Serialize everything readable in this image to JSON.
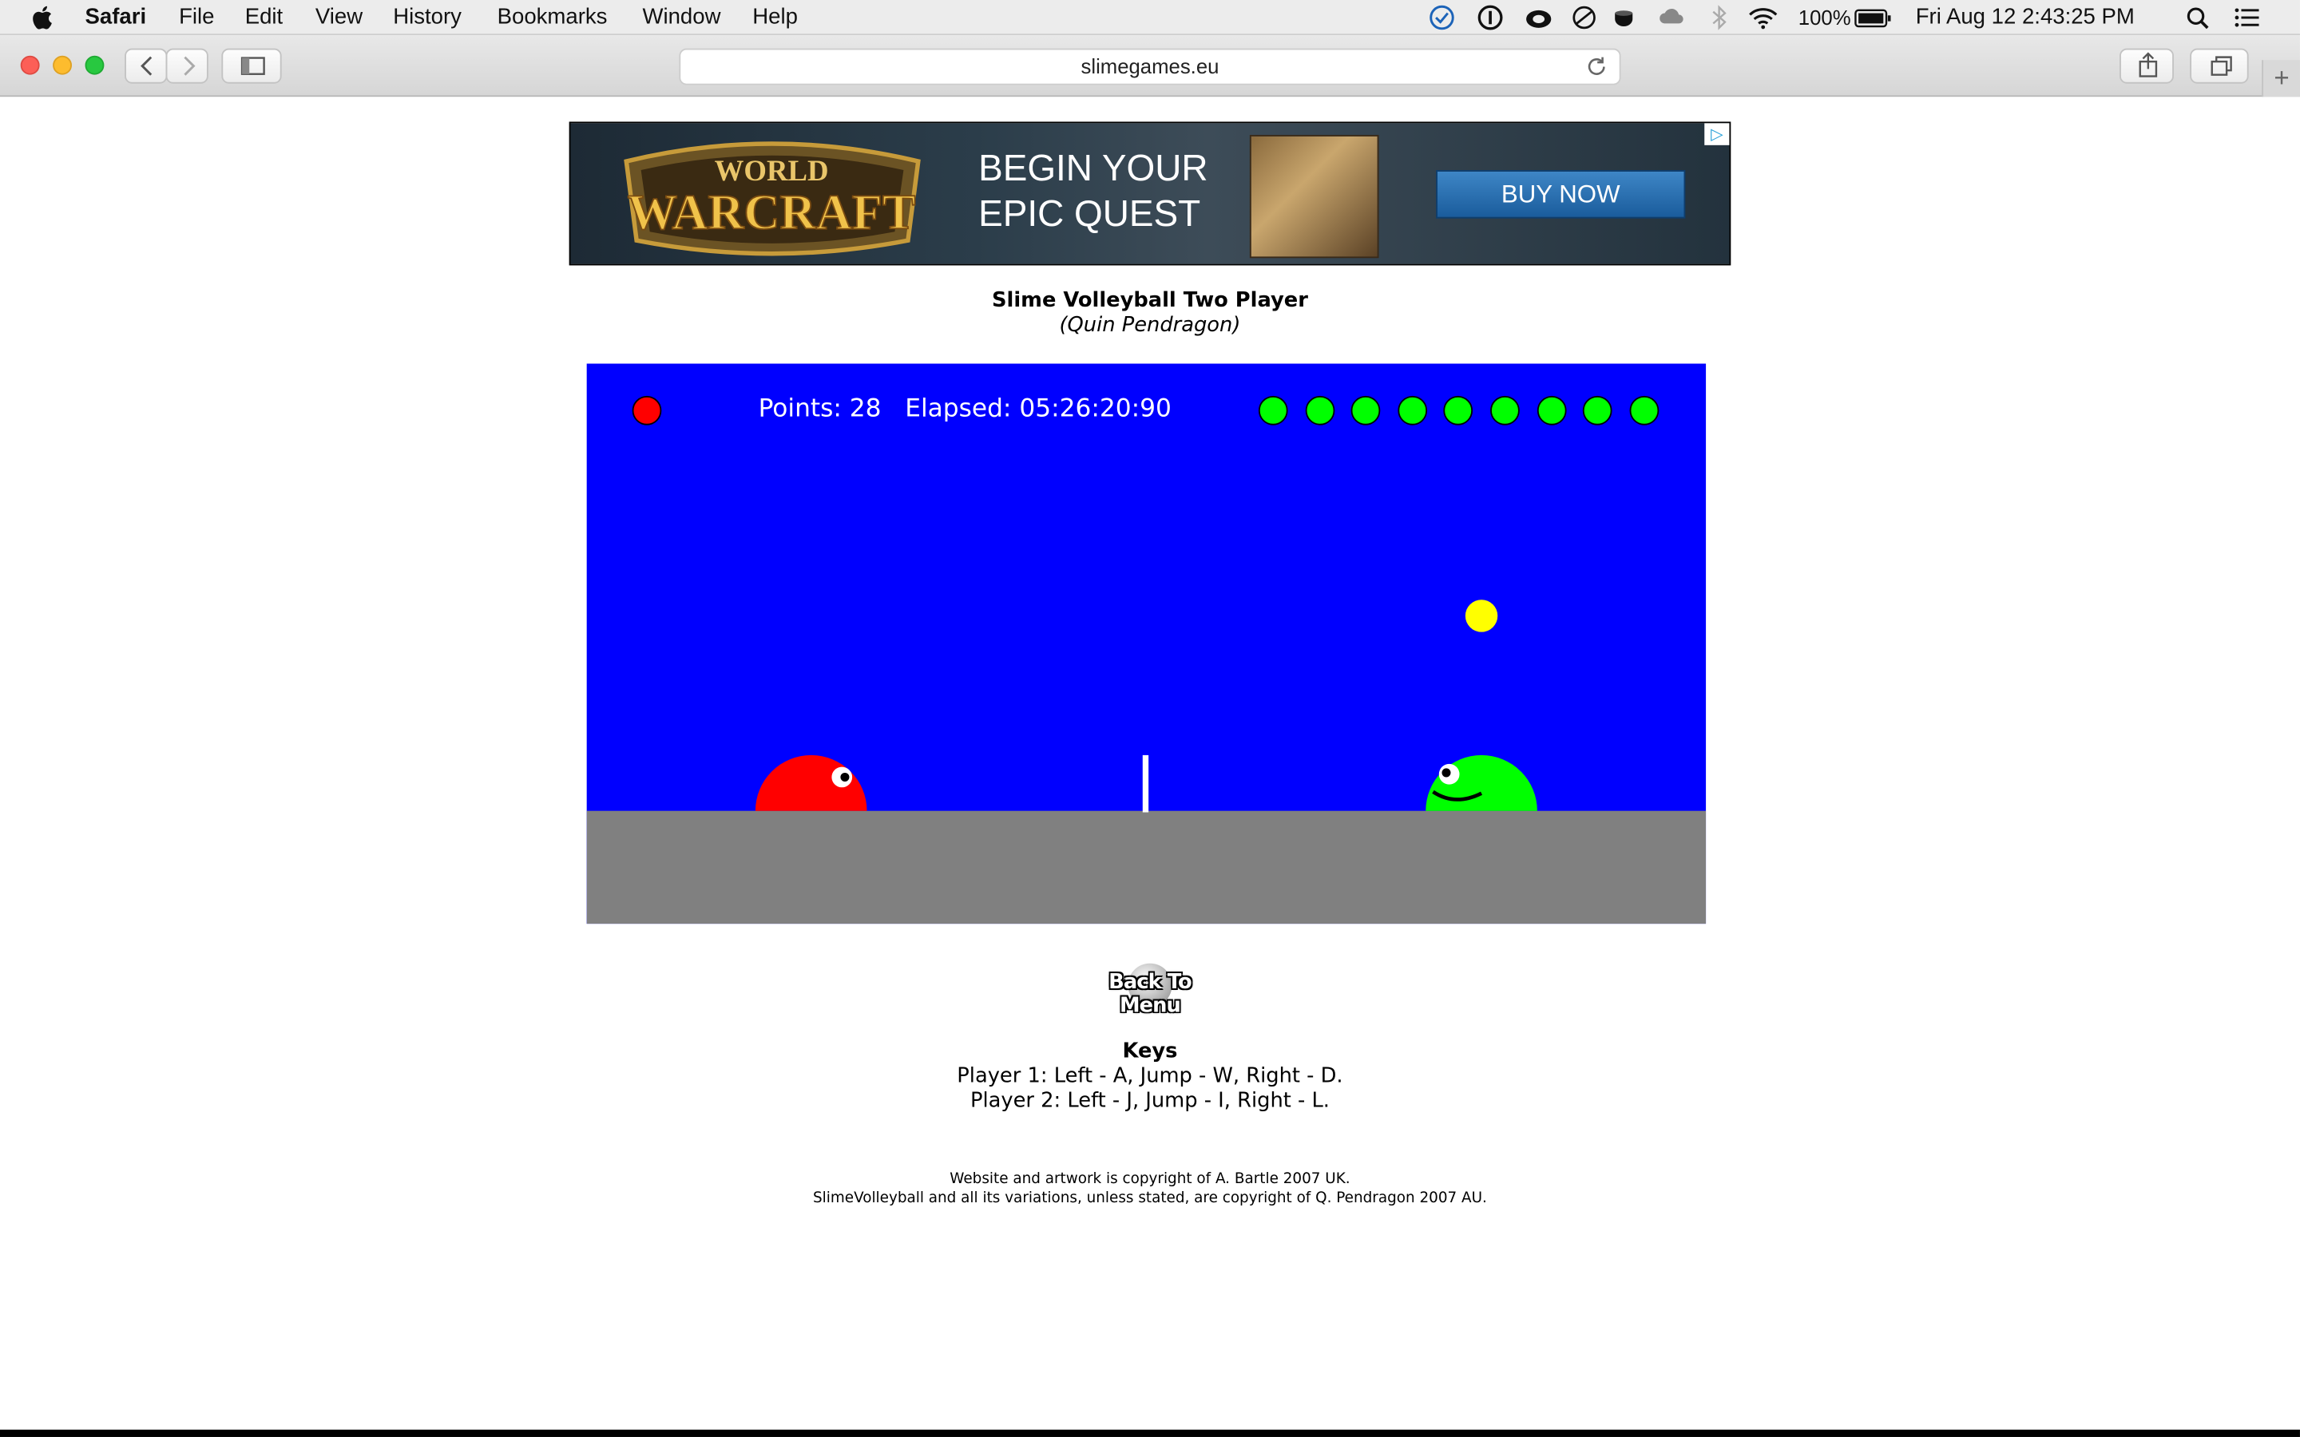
{
  "menubar": {
    "app_name": "Safari",
    "items": [
      "File",
      "Edit",
      "View",
      "History",
      "Bookmarks",
      "Window",
      "Help"
    ],
    "battery": "100%",
    "clock": "Fri Aug 12  2:43:25 PM"
  },
  "browser": {
    "url": "slimegames.eu",
    "new_tab": "+"
  },
  "ad": {
    "logo_line1": "WORLD",
    "logo_line2": "WARCRAFT",
    "tagline": "BEGIN YOUR EPIC QUEST",
    "button": "BUY NOW",
    "adchoices": "▷"
  },
  "page": {
    "title": "Slime Volleyball Two Player",
    "author": "(Quin Pendragon)"
  },
  "game": {
    "points": "Points: 28",
    "elapsed": "Elapsed: 05:26:20:90",
    "red_lives": 1,
    "green_lives": 9,
    "colors": {
      "sky": "#0000ff",
      "ground": "#808080",
      "player1": "#ff0000",
      "player2": "#00ff00",
      "ball": "#ffff00"
    }
  },
  "back_button": "Back To Menu",
  "keys": {
    "heading": "Keys",
    "player1": "Player 1: Left - A, Jump - W, Right - D.",
    "player2": "Player 2: Left - J, Jump - I, Right - L."
  },
  "footer": {
    "line1": "Website and artwork is copyright of A. Bartle 2007 UK.",
    "line2": "SlimeVolleyball and all its variations, unless stated, are copyright of Q. Pendragon 2007 AU."
  }
}
